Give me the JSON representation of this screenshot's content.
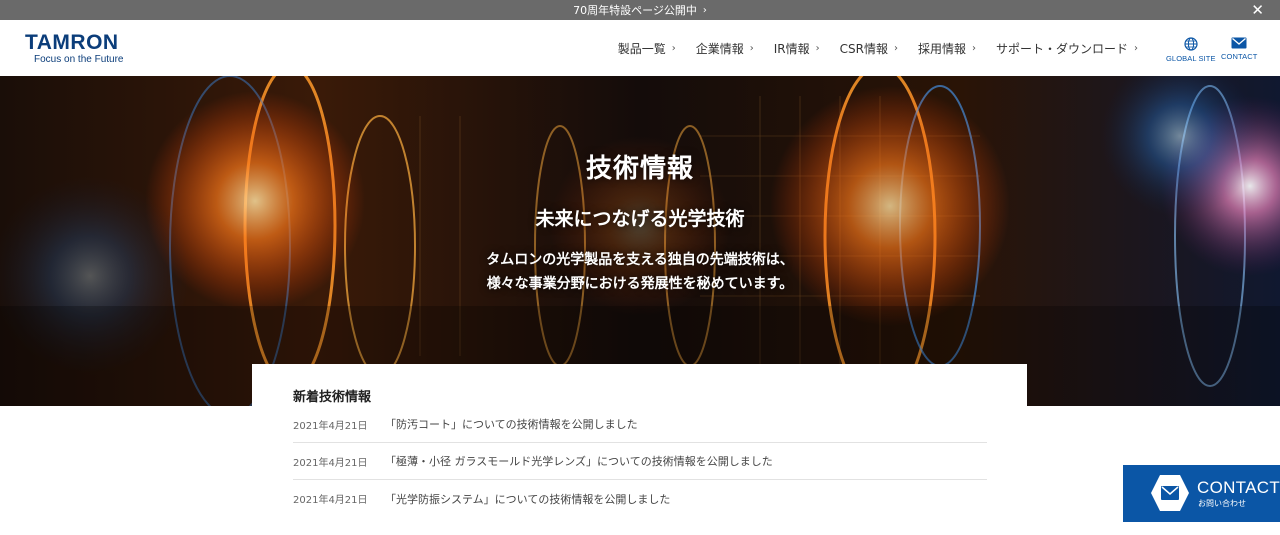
{
  "announcement": {
    "text": "70周年特設ページ公開中",
    "close_icon": "close-icon"
  },
  "header": {
    "logo": {
      "main": "TAMRON",
      "tagline": "Focus on the Future"
    },
    "nav": [
      {
        "label": "製品一覧"
      },
      {
        "label": "企業情報"
      },
      {
        "label": "IR情報"
      },
      {
        "label": "CSR情報"
      },
      {
        "label": "採用情報"
      },
      {
        "label": "サポート・ダウンロード"
      }
    ],
    "global_site": {
      "label": "GLOBAL SITE",
      "icon": "globe-icon"
    },
    "contact": {
      "label": "CONTACT",
      "icon": "mail-icon"
    }
  },
  "hero": {
    "title": "技術情報",
    "subtitle": "未来につなげる光学技術",
    "desc_line1": "タムロンの光学製品を支える独自の先端技術は、",
    "desc_line2": "様々な事業分野における発展性を秘めています。"
  },
  "news": {
    "heading": "新着技術情報",
    "items": [
      {
        "date": "2021年4月21日",
        "text": "「防汚コート」についての技術情報を公開しました"
      },
      {
        "date": "2021年4月21日",
        "text": "「極薄・小径 ガラスモールド光学レンズ」についての技術情報を公開しました"
      },
      {
        "date": "2021年4月21日",
        "text": "「光学防振システム」についての技術情報を公開しました"
      }
    ]
  },
  "contact_float": {
    "label_en": "CONTACT",
    "label_ja": "お問い合わせ",
    "icon": "mail-icon"
  },
  "colors": {
    "brand": "#0b3d7a",
    "accent": "#0b56a6",
    "topbar": "#6a6a6a"
  }
}
